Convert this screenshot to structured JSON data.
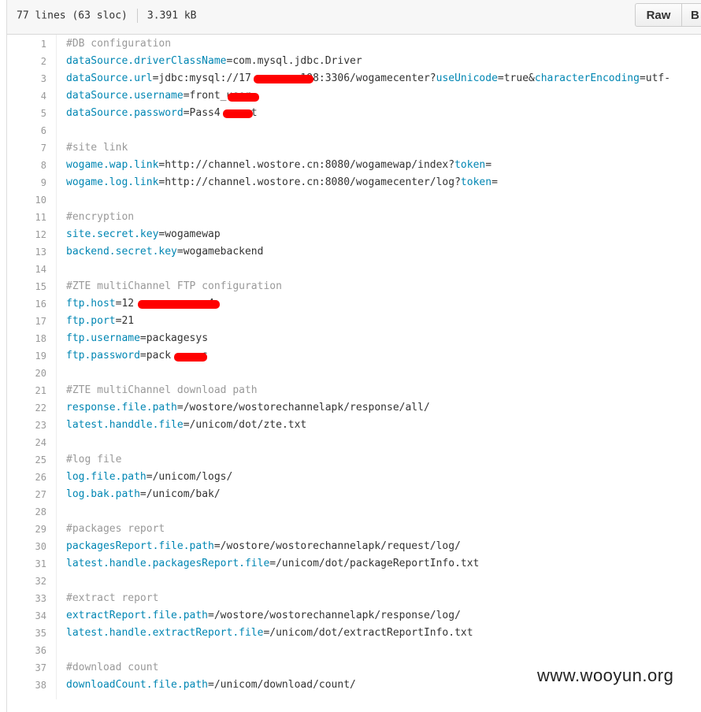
{
  "file_info": {
    "lines": "77 lines (63 sloc)",
    "size": "3.391 kB"
  },
  "buttons": {
    "raw": "Raw",
    "blame": "B"
  },
  "code_lines": [
    {
      "n": "1",
      "segs": [
        [
          "c",
          "#DB configuration"
        ]
      ]
    },
    {
      "n": "2",
      "segs": [
        [
          "k",
          "dataSource.driverClassName"
        ],
        [
          "t",
          "=com.mysql.jdbc.Driver"
        ]
      ]
    },
    {
      "n": "3",
      "segs": [
        [
          "k",
          "dataSource.url"
        ],
        [
          "t",
          "=jdbc:mysql://17"
        ],
        [
          "t",
          "       "
        ],
        [
          "t",
          ".198:3306/wogamecenter?"
        ],
        [
          "k",
          "useUnicode"
        ],
        [
          "t",
          "=true&"
        ],
        [
          "k",
          "characterEncoding"
        ],
        [
          "t",
          "=utf-"
        ]
      ]
    },
    {
      "n": "4",
      "segs": [
        [
          "k",
          "dataSource.username"
        ],
        [
          "t",
          "=front_user"
        ]
      ]
    },
    {
      "n": "5",
      "segs": [
        [
          "k",
          "dataSource.password"
        ],
        [
          "t",
          "=Pass4     t"
        ]
      ]
    },
    {
      "n": "6",
      "segs": []
    },
    {
      "n": "7",
      "segs": [
        [
          "c",
          "#site link"
        ]
      ]
    },
    {
      "n": "8",
      "segs": [
        [
          "k",
          "wogame.wap.link"
        ],
        [
          "t",
          "=http://channel.wostore.cn:8080/wogamewap/index?"
        ],
        [
          "k",
          "token"
        ],
        [
          "t",
          "="
        ]
      ]
    },
    {
      "n": "9",
      "segs": [
        [
          "k",
          "wogame.log.link"
        ],
        [
          "t",
          "=http://channel.wostore.cn:8080/wogamecenter/log?"
        ],
        [
          "k",
          "token"
        ],
        [
          "t",
          "="
        ]
      ]
    },
    {
      "n": "10",
      "segs": []
    },
    {
      "n": "11",
      "segs": [
        [
          "c",
          "#encryption"
        ]
      ]
    },
    {
      "n": "12",
      "segs": [
        [
          "k",
          "site.secret.key"
        ],
        [
          "t",
          "=wogamewap"
        ]
      ]
    },
    {
      "n": "13",
      "segs": [
        [
          "k",
          "backend.secret.key"
        ],
        [
          "t",
          "=wogamebackend"
        ]
      ]
    },
    {
      "n": "14",
      "segs": []
    },
    {
      "n": "15",
      "segs": [
        [
          "c",
          "#ZTE multiChannel FTP configuration"
        ]
      ]
    },
    {
      "n": "16",
      "segs": [
        [
          "k",
          "ftp.host"
        ],
        [
          "t",
          "=12            4"
        ]
      ]
    },
    {
      "n": "17",
      "segs": [
        [
          "k",
          "ftp.port"
        ],
        [
          "t",
          "=21"
        ]
      ]
    },
    {
      "n": "18",
      "segs": [
        [
          "k",
          "ftp.username"
        ],
        [
          "t",
          "=packagesys"
        ]
      ]
    },
    {
      "n": "19",
      "segs": [
        [
          "k",
          "ftp.password"
        ],
        [
          "t",
          "=pack     s"
        ]
      ]
    },
    {
      "n": "20",
      "segs": []
    },
    {
      "n": "21",
      "segs": [
        [
          "c",
          "#ZTE multiChannel download path"
        ]
      ]
    },
    {
      "n": "22",
      "segs": [
        [
          "k",
          "response.file.path"
        ],
        [
          "t",
          "=/wostore/wostorechannelapk/response/all/"
        ]
      ]
    },
    {
      "n": "23",
      "segs": [
        [
          "k",
          "latest.handdle.file"
        ],
        [
          "t",
          "=/unicom/dot/zte.txt"
        ]
      ]
    },
    {
      "n": "24",
      "segs": []
    },
    {
      "n": "25",
      "segs": [
        [
          "c",
          "#log file"
        ]
      ]
    },
    {
      "n": "26",
      "segs": [
        [
          "k",
          "log.file.path"
        ],
        [
          "t",
          "=/unicom/logs/"
        ]
      ]
    },
    {
      "n": "27",
      "segs": [
        [
          "k",
          "log.bak.path"
        ],
        [
          "t",
          "=/unicom/bak/"
        ]
      ]
    },
    {
      "n": "28",
      "segs": []
    },
    {
      "n": "29",
      "segs": [
        [
          "c",
          "#packages report"
        ]
      ]
    },
    {
      "n": "30",
      "segs": [
        [
          "k",
          "packagesReport.file.path"
        ],
        [
          "t",
          "=/wostore/wostorechannelapk/request/log/"
        ]
      ]
    },
    {
      "n": "31",
      "segs": [
        [
          "k",
          "latest.handle.packagesReport.file"
        ],
        [
          "t",
          "=/unicom/dot/packageReportInfo.txt"
        ]
      ]
    },
    {
      "n": "32",
      "segs": []
    },
    {
      "n": "33",
      "segs": [
        [
          "c",
          "#extract report"
        ]
      ]
    },
    {
      "n": "34",
      "segs": [
        [
          "k",
          "extractReport.file.path"
        ],
        [
          "t",
          "=/wostore/wostorechannelapk/response/log/"
        ]
      ]
    },
    {
      "n": "35",
      "segs": [
        [
          "k",
          "latest.handle.extractReport.file"
        ],
        [
          "t",
          "=/unicom/dot/extractReportInfo.txt"
        ]
      ]
    },
    {
      "n": "36",
      "segs": []
    },
    {
      "n": "37",
      "segs": [
        [
          "c",
          "#download count"
        ]
      ]
    },
    {
      "n": "38",
      "segs": [
        [
          "k",
          "downloadCount.file.path"
        ],
        [
          "t",
          "=/unicom/download/count/"
        ]
      ]
    }
  ],
  "watermark": "www.wooyun.org"
}
